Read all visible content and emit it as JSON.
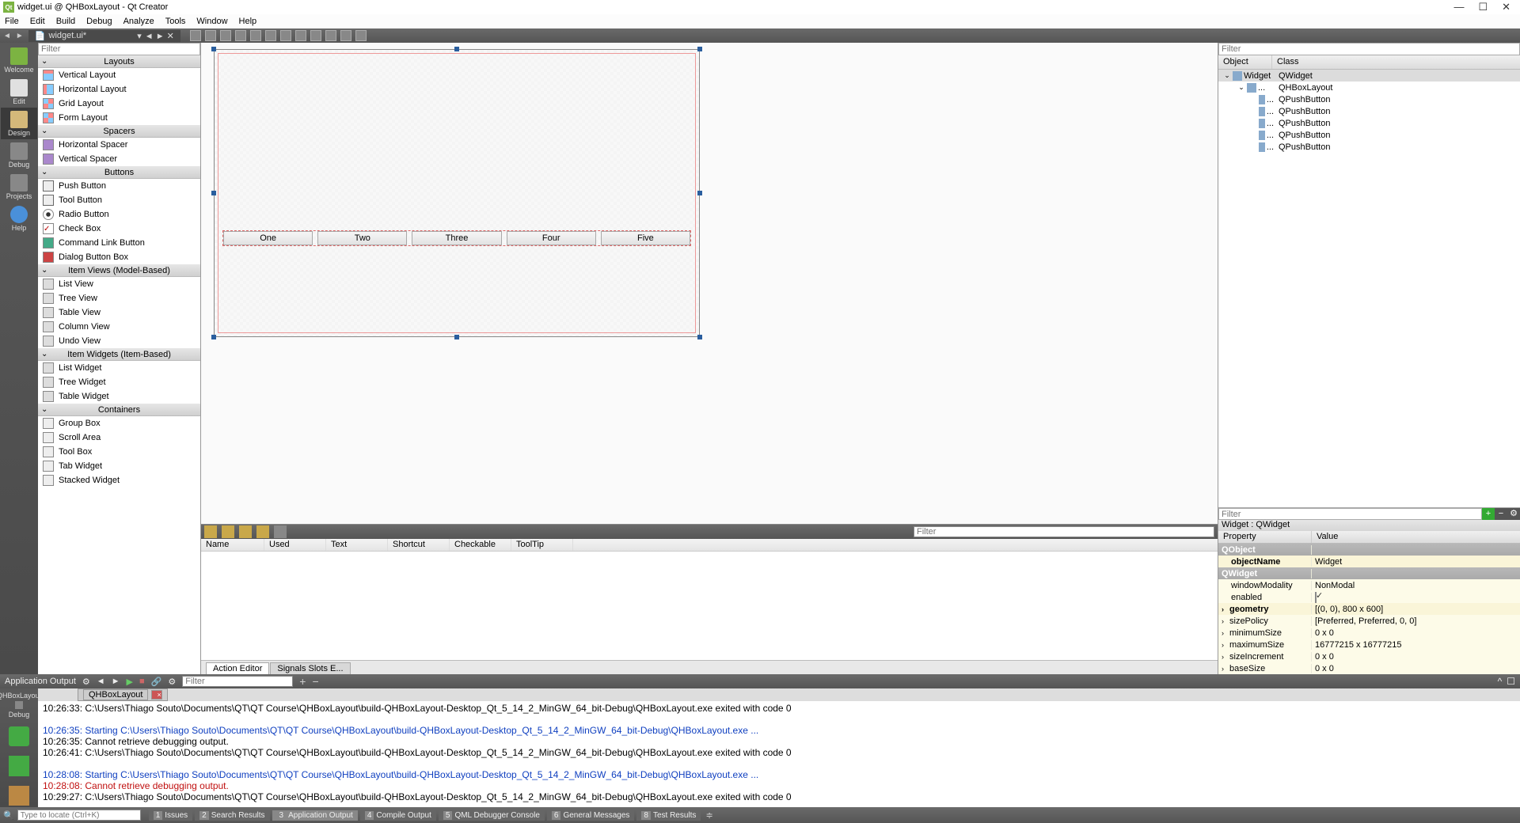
{
  "window": {
    "title": "widget.ui @ QHBoxLayout - Qt Creator",
    "controls": {
      "min": "—",
      "max": "☐",
      "close": "✕"
    }
  },
  "menubar": [
    "File",
    "Edit",
    "Build",
    "Debug",
    "Analyze",
    "Tools",
    "Window",
    "Help"
  ],
  "open_tab": "widget.ui*",
  "mode_sidebar": [
    {
      "label": "Welcome",
      "icon": "qt"
    },
    {
      "label": "Edit",
      "icon": "edit"
    },
    {
      "label": "Design",
      "icon": "design",
      "active": true
    },
    {
      "label": "Debug",
      "icon": "bug"
    },
    {
      "label": "Projects",
      "icon": "proj"
    },
    {
      "label": "Help",
      "icon": "help"
    }
  ],
  "widget_box": {
    "filter_placeholder": "Filter",
    "categories": [
      {
        "name": "Layouts",
        "items": [
          {
            "label": "Vertical Layout",
            "icon": "v"
          },
          {
            "label": "Horizontal Layout",
            "icon": "h"
          },
          {
            "label": "Grid Layout",
            "icon": "grid"
          },
          {
            "label": "Form Layout",
            "icon": "grid"
          }
        ]
      },
      {
        "name": "Spacers",
        "items": [
          {
            "label": "Horizontal Spacer",
            "icon": "spacer-h"
          },
          {
            "label": "Vertical Spacer",
            "icon": "spacer-v"
          }
        ]
      },
      {
        "name": "Buttons",
        "items": [
          {
            "label": "Push Button",
            "icon": "btn"
          },
          {
            "label": "Tool Button",
            "icon": "btn"
          },
          {
            "label": "Radio Button",
            "icon": "radio"
          },
          {
            "label": "Check Box",
            "icon": "chk"
          },
          {
            "label": "Command Link Button",
            "icon": "cmd"
          },
          {
            "label": "Dialog Button Box",
            "icon": "dlg"
          }
        ]
      },
      {
        "name": "Item Views (Model-Based)",
        "items": [
          {
            "label": "List View",
            "icon": "view"
          },
          {
            "label": "Tree View",
            "icon": "view"
          },
          {
            "label": "Table View",
            "icon": "view"
          },
          {
            "label": "Column View",
            "icon": "view"
          },
          {
            "label": "Undo View",
            "icon": "view"
          }
        ]
      },
      {
        "name": "Item Widgets (Item-Based)",
        "items": [
          {
            "label": "List Widget",
            "icon": "view"
          },
          {
            "label": "Tree Widget",
            "icon": "view"
          },
          {
            "label": "Table Widget",
            "icon": "view"
          }
        ]
      },
      {
        "name": "Containers",
        "items": [
          {
            "label": "Group Box",
            "icon": "cont"
          },
          {
            "label": "Scroll Area",
            "icon": "cont"
          },
          {
            "label": "Tool Box",
            "icon": "cont"
          },
          {
            "label": "Tab Widget",
            "icon": "cont"
          },
          {
            "label": "Stacked Widget",
            "icon": "cont"
          }
        ]
      }
    ]
  },
  "canvas": {
    "buttons": [
      "One",
      "Two",
      "Three",
      "Four",
      "Five"
    ]
  },
  "action_editor": {
    "filter_placeholder": "Filter",
    "columns": [
      "Name",
      "Used",
      "Text",
      "Shortcut",
      "Checkable",
      "ToolTip"
    ],
    "tabs": [
      "Action Editor",
      "Signals  Slots E..."
    ],
    "active_tab": 0
  },
  "object_inspector": {
    "filter_placeholder": "Filter",
    "columns": [
      "Object",
      "Class"
    ],
    "tree": [
      {
        "depth": 0,
        "name": "Widget",
        "class": "QWidget",
        "sel": true,
        "exp": "v"
      },
      {
        "depth": 1,
        "name": "...",
        "class": "QHBoxLayout",
        "exp": "v"
      },
      {
        "depth": 2,
        "name": "...",
        "class": "QPushButton"
      },
      {
        "depth": 2,
        "name": "...",
        "class": "QPushButton"
      },
      {
        "depth": 2,
        "name": "...",
        "class": "QPushButton"
      },
      {
        "depth": 2,
        "name": "...",
        "class": "QPushButton"
      },
      {
        "depth": 2,
        "name": "...",
        "class": "QPushButton"
      }
    ]
  },
  "property_editor": {
    "filter_placeholder": "Filter",
    "title": "Widget : QWidget",
    "columns": [
      "Property",
      "Value"
    ],
    "rows": [
      {
        "type": "cat",
        "name": "QObject"
      },
      {
        "type": "p",
        "name": "objectName",
        "value": "Widget",
        "bg": "yel2",
        "bold": true
      },
      {
        "type": "cat",
        "name": "QWidget"
      },
      {
        "type": "p",
        "name": "windowModality",
        "value": "NonModal",
        "bg": "yel"
      },
      {
        "type": "p",
        "name": "enabled",
        "value": "[check]",
        "bg": "yel"
      },
      {
        "type": "p",
        "name": "geometry",
        "value": "[(0, 0), 800 x 600]",
        "bg": "yel2",
        "bold": true,
        "exp": true
      },
      {
        "type": "p",
        "name": "sizePolicy",
        "value": "[Preferred, Preferred, 0, 0]",
        "bg": "yel",
        "exp": true
      },
      {
        "type": "p",
        "name": "minimumSize",
        "value": "0 x 0",
        "bg": "yel",
        "exp": true
      },
      {
        "type": "p",
        "name": "maximumSize",
        "value": "16777215 x 16777215",
        "bg": "yel",
        "exp": true
      },
      {
        "type": "p",
        "name": "sizeIncrement",
        "value": "0 x 0",
        "bg": "yel",
        "exp": true
      },
      {
        "type": "p",
        "name": "baseSize",
        "value": "0 x 0",
        "bg": "yel",
        "exp": true
      }
    ]
  },
  "output": {
    "title": "Application Output",
    "search_placeholder": "Filter",
    "tab": "QHBoxLayout",
    "left_items": [
      {
        "label": "QHBoxLayout"
      },
      {
        "label": "Debug"
      }
    ],
    "lines": [
      {
        "cls": "",
        "text": "10:26:33: C:\\Users\\Thiago Souto\\Documents\\QT\\QT Course\\QHBoxLayout\\build-QHBoxLayout-Desktop_Qt_5_14_2_MinGW_64_bit-Debug\\QHBoxLayout.exe exited with code 0"
      },
      {
        "cls": "",
        "text": ""
      },
      {
        "cls": "blue",
        "text": "10:26:35: Starting C:\\Users\\Thiago Souto\\Documents\\QT\\QT Course\\QHBoxLayout\\build-QHBoxLayout-Desktop_Qt_5_14_2_MinGW_64_bit-Debug\\QHBoxLayout.exe ..."
      },
      {
        "cls": "",
        "text": "10:26:35: Cannot retrieve debugging output."
      },
      {
        "cls": "",
        "text": "10:26:41: C:\\Users\\Thiago Souto\\Documents\\QT\\QT Course\\QHBoxLayout\\build-QHBoxLayout-Desktop_Qt_5_14_2_MinGW_64_bit-Debug\\QHBoxLayout.exe exited with code 0"
      },
      {
        "cls": "",
        "text": ""
      },
      {
        "cls": "blue",
        "text": "10:28:08: Starting C:\\Users\\Thiago Souto\\Documents\\QT\\QT Course\\QHBoxLayout\\build-QHBoxLayout-Desktop_Qt_5_14_2_MinGW_64_bit-Debug\\QHBoxLayout.exe ..."
      },
      {
        "cls": "red",
        "text": "10:28:08: Cannot retrieve debugging output."
      },
      {
        "cls": "",
        "text": "10:29:27: C:\\Users\\Thiago Souto\\Documents\\QT\\QT Course\\QHBoxLayout\\build-QHBoxLayout-Desktop_Qt_5_14_2_MinGW_64_bit-Debug\\QHBoxLayout.exe exited with code 0"
      }
    ]
  },
  "statusbar": {
    "locator_placeholder": "Type to locate (Ctrl+K)",
    "tabs": [
      {
        "num": "1",
        "label": "Issues"
      },
      {
        "num": "2",
        "label": "Search Results"
      },
      {
        "num": "3",
        "label": "Application Output",
        "active": true
      },
      {
        "num": "4",
        "label": "Compile Output"
      },
      {
        "num": "5",
        "label": "QML Debugger Console"
      },
      {
        "num": "6",
        "label": "General Messages"
      },
      {
        "num": "8",
        "label": "Test Results"
      }
    ]
  }
}
